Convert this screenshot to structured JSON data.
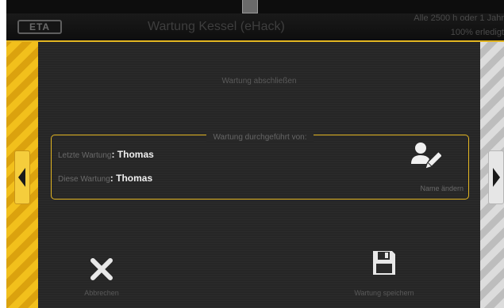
{
  "header": {
    "logo_text": "ETA",
    "title": "Wartung Kessel (eHack)",
    "status_line1": "Alle 2500 h oder 1 Jahr",
    "status_line2": "100% erledigt"
  },
  "main": {
    "heading": "Wartung abschließen",
    "group_legend": "Wartung durchgeführt von:",
    "rows": [
      {
        "label": "Letzte Wartung",
        "separator": ": ",
        "value": "Thomas"
      },
      {
        "label": "Diese Wartung",
        "separator": ": ",
        "value": "Thomas"
      }
    ],
    "edit_name_label": "Name ändern",
    "edit_name_icon": "user-edit-icon"
  },
  "footer": {
    "cancel_label": "Abbrechen",
    "cancel_icon": "close-icon",
    "save_label": "Wartung speichern",
    "save_icon": "floppy-disk-icon"
  },
  "nav": {
    "prev_icon": "triangle-left-icon",
    "next_icon": "triangle-right-icon"
  },
  "colors": {
    "accent": "#e3b622",
    "background": "#262626",
    "value_text": "#f0f0f0"
  }
}
